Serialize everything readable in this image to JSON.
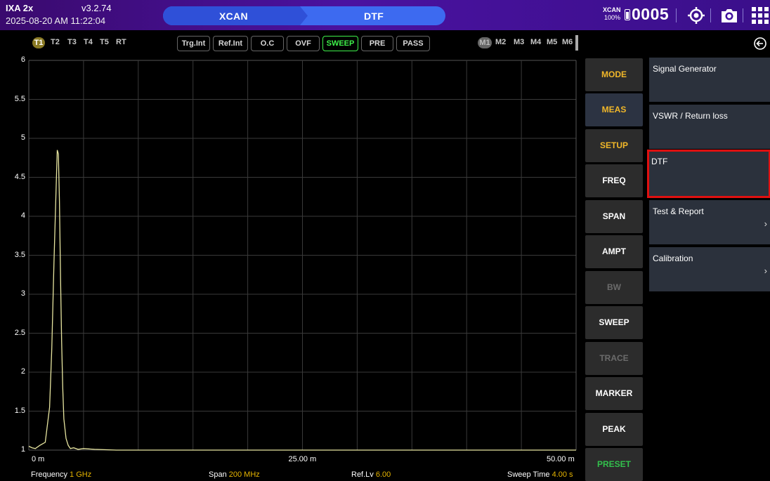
{
  "header": {
    "device": "IXA 2x",
    "version": "v3.2.74",
    "datetime": "2025-08-20 AM 11:22:04",
    "mode_left": "XCAN",
    "mode_right": "DTF",
    "battery_brand": "XCAN",
    "battery_percent": "100%",
    "count": "0005",
    "icons": [
      "gps-icon",
      "camera-icon",
      "apps-grid-icon"
    ]
  },
  "traces": [
    "T1",
    "T2",
    "T3",
    "T4",
    "T5",
    "RT"
  ],
  "status_buttons": [
    {
      "label": "Trg.Int",
      "active": false
    },
    {
      "label": "Ref.Int",
      "active": false
    },
    {
      "label": "O.C",
      "active": false
    },
    {
      "label": "OVF",
      "active": false
    },
    {
      "label": "SWEEP",
      "active": true
    },
    {
      "label": "PRE",
      "active": false
    },
    {
      "label": "PASS",
      "active": false
    }
  ],
  "markers": [
    "M1",
    "M2",
    "M3",
    "M4",
    "M5",
    "M6"
  ],
  "chart_data": {
    "type": "line",
    "yticks": [
      "6",
      "5.5",
      "5",
      "4.5",
      "4",
      "3.5",
      "3",
      "2.5",
      "2",
      "1.5",
      "1"
    ],
    "xticks": [
      "0 m",
      "25.00 m",
      "50.00 m"
    ],
    "ylim": [
      1,
      6
    ],
    "xlim": [
      0,
      50
    ],
    "grid": true,
    "trace_color": "#e8e6a0",
    "series": [
      {
        "x": [
          0,
          0.3,
          0.6,
          1.0,
          1.5,
          1.9,
          2.1,
          2.3,
          2.5,
          2.6,
          2.7,
          2.8,
          2.9,
          3.0,
          3.1,
          3.2,
          3.4,
          3.6,
          3.8,
          4.1,
          4.5,
          5.0,
          6.0,
          8.0,
          12.0,
          20.0,
          30.0,
          40.0,
          50.0
        ],
        "y": [
          1.05,
          1.03,
          1.02,
          1.06,
          1.1,
          1.55,
          2.3,
          3.4,
          4.4,
          4.85,
          4.8,
          4.2,
          3.2,
          2.4,
          1.8,
          1.4,
          1.15,
          1.06,
          1.02,
          1.03,
          1.01,
          1.02,
          1.01,
          1.0,
          1.0,
          1.0,
          1.0,
          1.0,
          1.0
        ]
      }
    ]
  },
  "footer": {
    "freq_label": "Frequency",
    "freq_value": "1 GHz",
    "span_label": "Span",
    "span_value": "200 MHz",
    "ref_label": "Ref.Lv",
    "ref_value": "6.00",
    "sweep_label": "Sweep Time",
    "sweep_value": "4.00 s"
  },
  "menu": [
    {
      "label": "MODE",
      "style": "yellow"
    },
    {
      "label": "MEAS",
      "style": "yellow-active"
    },
    {
      "label": "SETUP",
      "style": "yellow"
    },
    {
      "label": "FREQ",
      "style": "normal"
    },
    {
      "label": "SPAN",
      "style": "normal"
    },
    {
      "label": "AMPT",
      "style": "normal"
    },
    {
      "label": "BW",
      "style": "dim"
    },
    {
      "label": "SWEEP",
      "style": "normal"
    },
    {
      "label": "TRACE",
      "style": "dim"
    },
    {
      "label": "MARKER",
      "style": "normal"
    },
    {
      "label": "PEAK",
      "style": "normal"
    },
    {
      "label": "PRESET",
      "style": "green"
    }
  ],
  "submenu": [
    {
      "label": "Signal Generator",
      "chevron": ""
    },
    {
      "label": "VSWR / Return loss",
      "chevron": ""
    },
    {
      "label": "DTF",
      "chevron": "",
      "selected": true
    },
    {
      "label": "Test & Report",
      "chevron": "›"
    },
    {
      "label": "Calibration",
      "chevron": "›"
    }
  ]
}
